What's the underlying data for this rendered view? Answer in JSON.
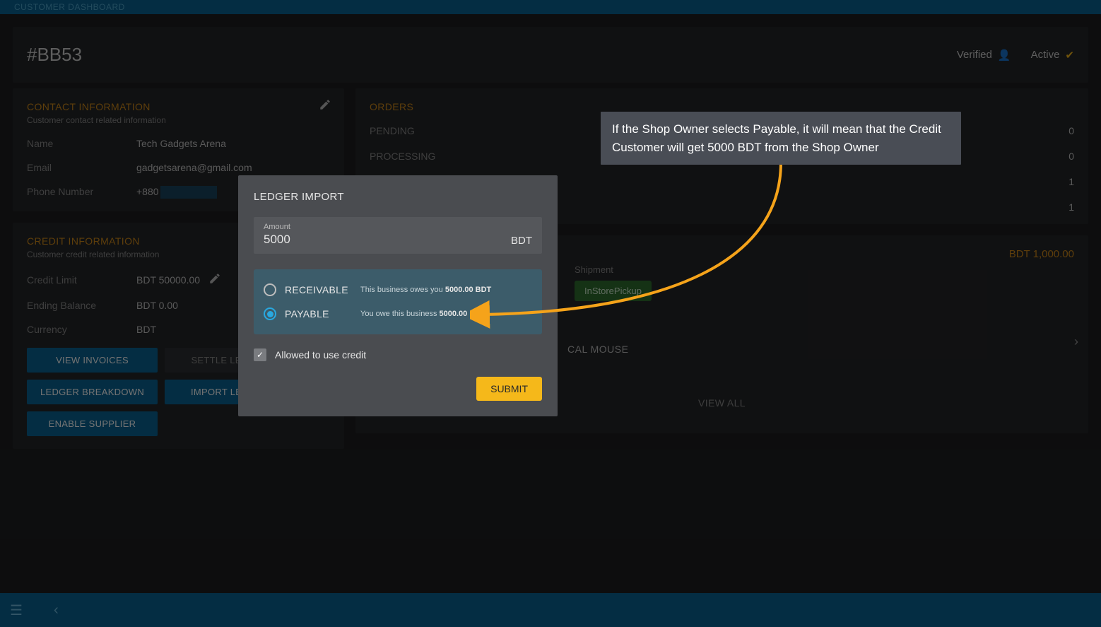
{
  "topbar": {
    "title": "CUSTOMER DASHBOARD"
  },
  "header": {
    "code": "#BB53",
    "verified": "Verified",
    "active": "Active"
  },
  "contact": {
    "title": "CONTACT INFORMATION",
    "sub": "Customer contact related information",
    "name_k": "Name",
    "name_v": "Tech Gadgets Arena",
    "email_k": "Email",
    "email_v": "gadgetsarena@gmail.com",
    "phone_k": "Phone Number",
    "phone_v": "+880"
  },
  "credit": {
    "title": "CREDIT INFORMATION",
    "sub": "Customer credit related information",
    "limit_k": "Credit Limit",
    "limit_v": "BDT 50000.00",
    "bal_k": "Ending Balance",
    "bal_v": "BDT 0.00",
    "cur_k": "Currency",
    "cur_v": "BDT",
    "btns": {
      "invoices": "VIEW INVOICES",
      "settle": "SETTLE LEDGER",
      "breakdown": "LEDGER BREAKDOWN",
      "import": "IMPORT LEDGER",
      "enable": "ENABLE SUPPLIER"
    }
  },
  "orders": {
    "title": "ORDERS",
    "rows": [
      {
        "label": "PENDING",
        "n": "0"
      },
      {
        "label": "PROCESSING",
        "n": "0"
      },
      {
        "label": "",
        "n": "1"
      },
      {
        "label": "",
        "n": "1"
      }
    ],
    "amount": "BDT 1,000.00",
    "ship_lbl": "Shipment",
    "ship_badge": "InStorePickup",
    "product": "CAL MOUSE",
    "viewall": "VIEW ALL"
  },
  "modal": {
    "title": "LEDGER IMPORT",
    "amount_label": "Amount",
    "amount_value": "5000",
    "currency": "BDT",
    "receivable": "RECEIVABLE",
    "receivable_txt": "This business owes you",
    "receivable_amt": "5000.00 BDT",
    "payable": "PAYABLE",
    "payable_txt": "You owe this business",
    "payable_amt": "5000.00 BDT",
    "allow": "Allowed to use credit",
    "submit": "SUBMIT"
  },
  "annotation": "If the Shop Owner selects Payable, it will mean that the Credit Customer will get 5000 BDT from the Shop Owner"
}
